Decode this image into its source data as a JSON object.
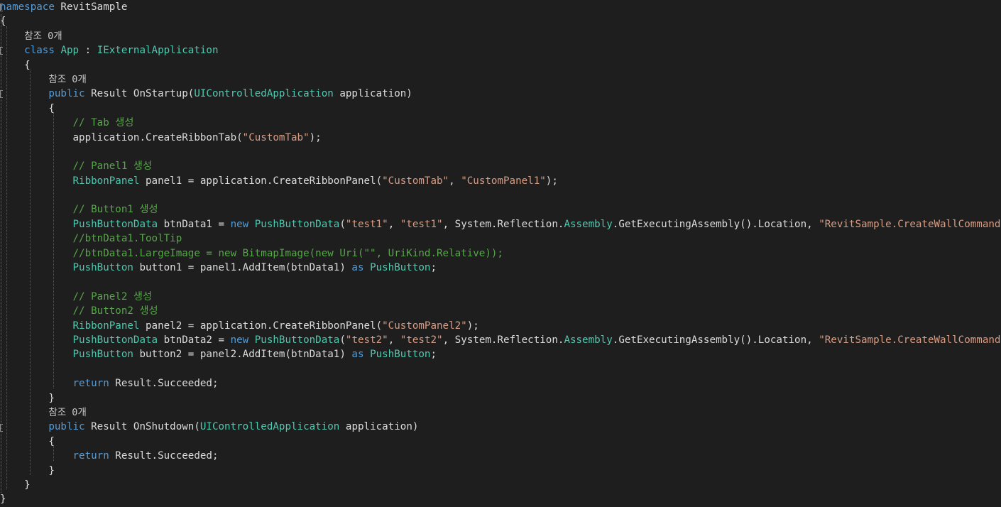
{
  "editor": {
    "colors": {
      "background": "#1e1e1e",
      "keyword": "#569cd6",
      "type": "#4ec9b0",
      "string": "#d69d85",
      "comment": "#57a64a",
      "plain": "#dcdcdc",
      "codelens": "#c8c8c8"
    },
    "lines": [
      [
        {
          "t": "keyword",
          "v": "namespace"
        },
        {
          "t": "plain",
          "v": " RevitSample"
        }
      ],
      [
        {
          "t": "plain",
          "v": "{"
        }
      ],
      [
        {
          "t": "plain",
          "v": "    "
        },
        {
          "t": "codelens",
          "v": "참조 0개"
        }
      ],
      [
        {
          "t": "plain",
          "v": "    "
        },
        {
          "t": "keyword",
          "v": "class"
        },
        {
          "t": "plain",
          "v": " "
        },
        {
          "t": "type",
          "v": "App"
        },
        {
          "t": "plain",
          "v": " : "
        },
        {
          "t": "type",
          "v": "IExternalApplication"
        }
      ],
      [
        {
          "t": "plain",
          "v": "    {"
        }
      ],
      [
        {
          "t": "plain",
          "v": "        "
        },
        {
          "t": "codelens",
          "v": "참조 0개"
        }
      ],
      [
        {
          "t": "plain",
          "v": "        "
        },
        {
          "t": "keyword",
          "v": "public"
        },
        {
          "t": "plain",
          "v": " Result OnStartup("
        },
        {
          "t": "type",
          "v": "UIControlledApplication"
        },
        {
          "t": "plain",
          "v": " application)"
        }
      ],
      [
        {
          "t": "plain",
          "v": "        {"
        }
      ],
      [
        {
          "t": "plain",
          "v": "            "
        },
        {
          "t": "comment",
          "v": "// Tab 생성"
        }
      ],
      [
        {
          "t": "plain",
          "v": "            application.CreateRibbonTab("
        },
        {
          "t": "string",
          "v": "\"CustomTab\""
        },
        {
          "t": "plain",
          "v": ");"
        }
      ],
      [],
      [
        {
          "t": "plain",
          "v": "            "
        },
        {
          "t": "comment",
          "v": "// Panel1 생성"
        }
      ],
      [
        {
          "t": "plain",
          "v": "            "
        },
        {
          "t": "type",
          "v": "RibbonPanel"
        },
        {
          "t": "plain",
          "v": " panel1 = application.CreateRibbonPanel("
        },
        {
          "t": "string",
          "v": "\"CustomTab\""
        },
        {
          "t": "plain",
          "v": ", "
        },
        {
          "t": "string",
          "v": "\"CustomPanel1\""
        },
        {
          "t": "plain",
          "v": ");"
        }
      ],
      [],
      [
        {
          "t": "plain",
          "v": "            "
        },
        {
          "t": "comment",
          "v": "// Button1 생성"
        }
      ],
      [
        {
          "t": "plain",
          "v": "            "
        },
        {
          "t": "type",
          "v": "PushButtonData"
        },
        {
          "t": "plain",
          "v": " btnData1 = "
        },
        {
          "t": "keyword",
          "v": "new"
        },
        {
          "t": "plain",
          "v": " "
        },
        {
          "t": "type",
          "v": "PushButtonData"
        },
        {
          "t": "plain",
          "v": "("
        },
        {
          "t": "string",
          "v": "\"test1\""
        },
        {
          "t": "plain",
          "v": ", "
        },
        {
          "t": "string",
          "v": "\"test1\""
        },
        {
          "t": "plain",
          "v": ", System.Reflection."
        },
        {
          "t": "type",
          "v": "Assembly"
        },
        {
          "t": "plain",
          "v": ".GetExecutingAssembly().Location, "
        },
        {
          "t": "string",
          "v": "\"RevitSample.CreateWallCommand\""
        },
        {
          "t": "plain",
          "v": ");"
        }
      ],
      [
        {
          "t": "plain",
          "v": "            "
        },
        {
          "t": "comment",
          "v": "//btnData1.ToolTip"
        }
      ],
      [
        {
          "t": "plain",
          "v": "            "
        },
        {
          "t": "comment",
          "v": "//btnData1.LargeImage = new BitmapImage(new Uri(\"\", UriKind.Relative));"
        }
      ],
      [
        {
          "t": "plain",
          "v": "            "
        },
        {
          "t": "type",
          "v": "PushButton"
        },
        {
          "t": "plain",
          "v": " button1 = panel1.AddItem(btnData1) "
        },
        {
          "t": "keyword",
          "v": "as"
        },
        {
          "t": "plain",
          "v": " "
        },
        {
          "t": "type",
          "v": "PushButton"
        },
        {
          "t": "plain",
          "v": ";"
        }
      ],
      [],
      [
        {
          "t": "plain",
          "v": "            "
        },
        {
          "t": "comment",
          "v": "// Panel2 생성"
        }
      ],
      [
        {
          "t": "plain",
          "v": "            "
        },
        {
          "t": "comment",
          "v": "// Button2 생성"
        }
      ],
      [
        {
          "t": "plain",
          "v": "            "
        },
        {
          "t": "type",
          "v": "RibbonPanel"
        },
        {
          "t": "plain",
          "v": " panel2 = application.CreateRibbonPanel("
        },
        {
          "t": "string",
          "v": "\"CustomPanel2\""
        },
        {
          "t": "plain",
          "v": ");"
        }
      ],
      [
        {
          "t": "plain",
          "v": "            "
        },
        {
          "t": "type",
          "v": "PushButtonData"
        },
        {
          "t": "plain",
          "v": " btnData2 = "
        },
        {
          "t": "keyword",
          "v": "new"
        },
        {
          "t": "plain",
          "v": " "
        },
        {
          "t": "type",
          "v": "PushButtonData"
        },
        {
          "t": "plain",
          "v": "("
        },
        {
          "t": "string",
          "v": "\"test2\""
        },
        {
          "t": "plain",
          "v": ", "
        },
        {
          "t": "string",
          "v": "\"test2\""
        },
        {
          "t": "plain",
          "v": ", System.Reflection."
        },
        {
          "t": "type",
          "v": "Assembly"
        },
        {
          "t": "plain",
          "v": ".GetExecutingAssembly().Location, "
        },
        {
          "t": "string",
          "v": "\"RevitSample.CreateWallCommand\""
        },
        {
          "t": "plain",
          "v": ");"
        }
      ],
      [
        {
          "t": "plain",
          "v": "            "
        },
        {
          "t": "type",
          "v": "PushButton"
        },
        {
          "t": "plain",
          "v": " button2 = panel2.AddItem(btnData1) "
        },
        {
          "t": "keyword",
          "v": "as"
        },
        {
          "t": "plain",
          "v": " "
        },
        {
          "t": "type",
          "v": "PushButton"
        },
        {
          "t": "plain",
          "v": ";"
        }
      ],
      [],
      [
        {
          "t": "plain",
          "v": "            "
        },
        {
          "t": "keyword",
          "v": "return"
        },
        {
          "t": "plain",
          "v": " Result.Succeeded;"
        }
      ],
      [
        {
          "t": "plain",
          "v": "        }"
        }
      ],
      [
        {
          "t": "plain",
          "v": "        "
        },
        {
          "t": "codelens",
          "v": "참조 0개"
        }
      ],
      [
        {
          "t": "plain",
          "v": "        "
        },
        {
          "t": "keyword",
          "v": "public"
        },
        {
          "t": "plain",
          "v": " Result OnShutdown("
        },
        {
          "t": "type",
          "v": "UIControlledApplication"
        },
        {
          "t": "plain",
          "v": " application)"
        }
      ],
      [
        {
          "t": "plain",
          "v": "        {"
        }
      ],
      [
        {
          "t": "plain",
          "v": "            "
        },
        {
          "t": "keyword",
          "v": "return"
        },
        {
          "t": "plain",
          "v": " Result.Succeeded;"
        }
      ],
      [
        {
          "t": "plain",
          "v": "        }"
        }
      ],
      [
        {
          "t": "plain",
          "v": "    }"
        }
      ],
      [
        {
          "t": "plain",
          "v": "}"
        }
      ]
    ]
  }
}
